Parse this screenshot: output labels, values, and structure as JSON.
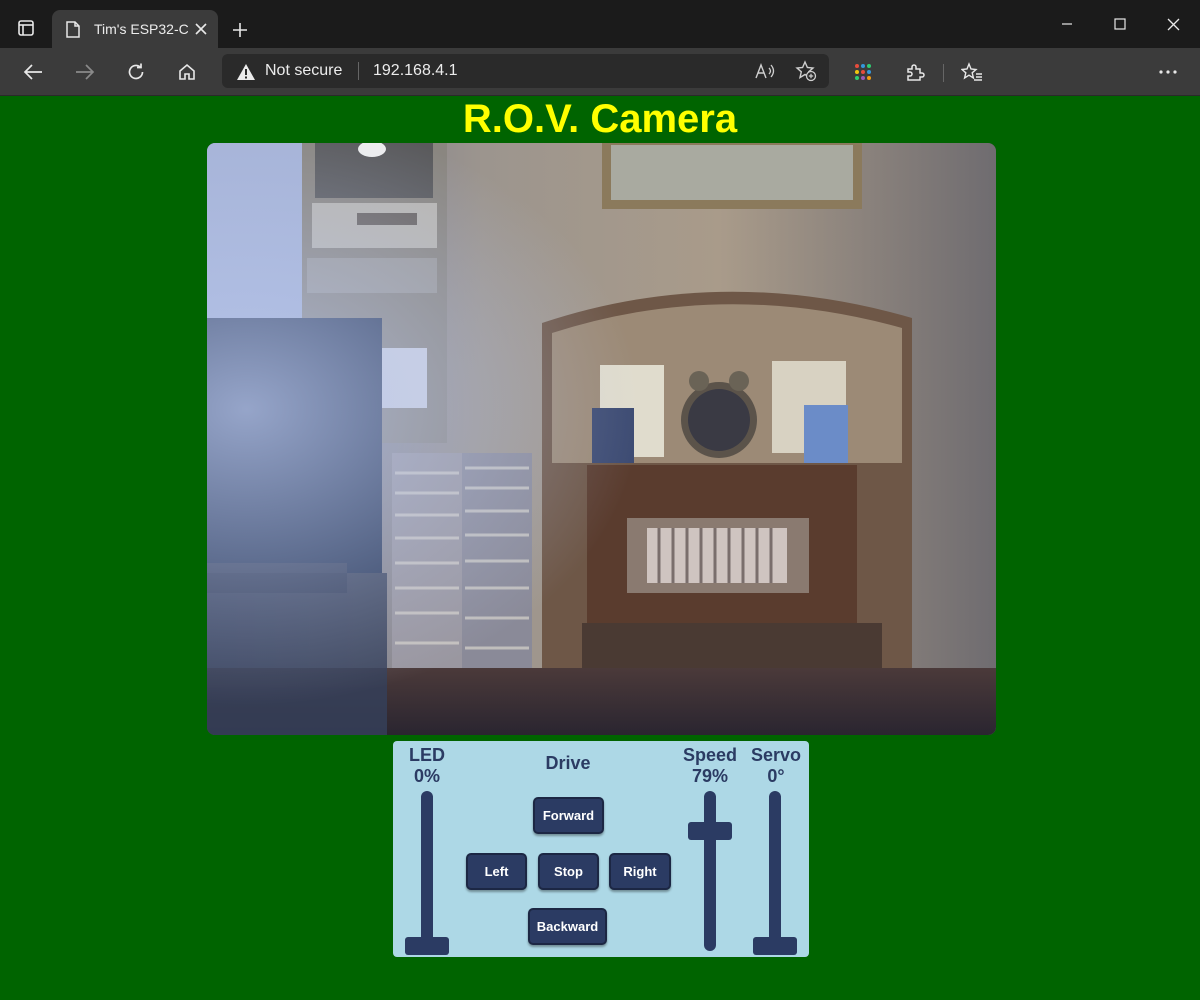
{
  "browser": {
    "tab_title": "Tim's ESP32-C",
    "not_secure": "Not secure",
    "url": "192.168.4.1",
    "colors": {
      "frame": "#1b1b1b",
      "toolbar": "#3b3b3b",
      "omnibox": "#2a2a2a"
    }
  },
  "page": {
    "title": "R.O.V. Camera",
    "colors": {
      "background": "#006400",
      "title": "#ffff00",
      "panel": "#add8e6",
      "control": "#2b3b63"
    }
  },
  "controls": {
    "led": {
      "label": "LED",
      "value": "0%",
      "level": 0
    },
    "drive": {
      "title": "Drive",
      "forward": "Forward",
      "left": "Left",
      "stop": "Stop",
      "right": "Right",
      "backward": "Backward"
    },
    "speed": {
      "label": "Speed",
      "value": "79%",
      "level": 0.79
    },
    "servo": {
      "label": "Servo",
      "value": "0°",
      "level": 0
    }
  }
}
